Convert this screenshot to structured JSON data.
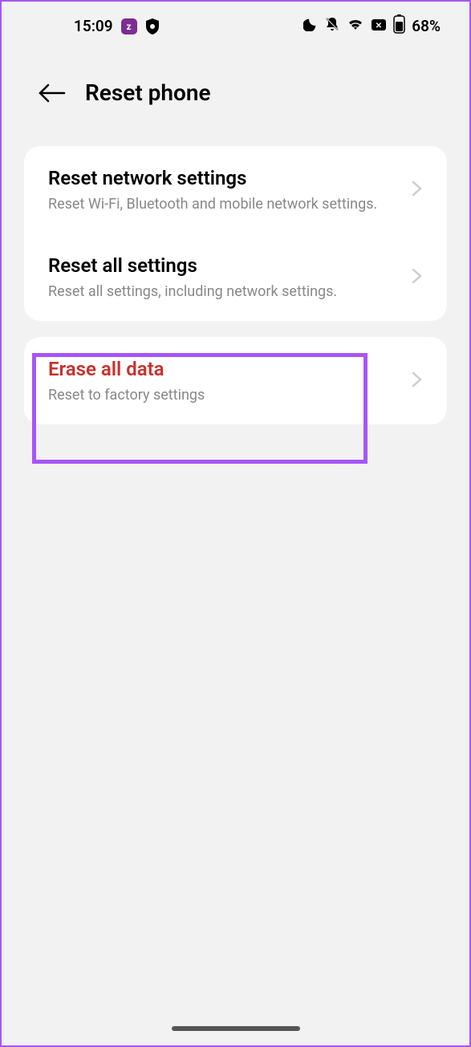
{
  "status_bar": {
    "time": "15:09",
    "battery_percent": "68%"
  },
  "header": {
    "title": "Reset phone"
  },
  "group1": {
    "items": [
      {
        "title": "Reset network settings",
        "subtitle": "Reset Wi-Fi, Bluetooth and mobile network settings."
      },
      {
        "title": "Reset all settings",
        "subtitle": "Reset all settings, including network settings."
      }
    ]
  },
  "group2": {
    "items": [
      {
        "title": "Erase all data",
        "subtitle": "Reset to factory settings"
      }
    ]
  }
}
